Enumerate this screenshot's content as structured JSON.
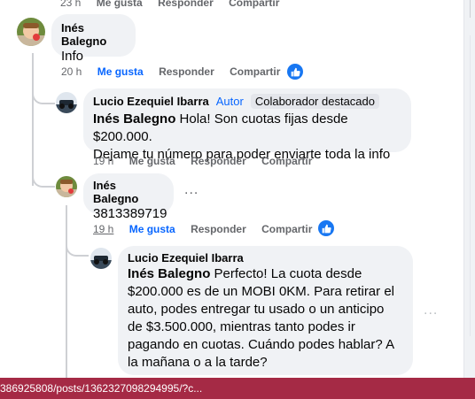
{
  "top_actions": {
    "time": "23 h",
    "like": "Me gusta",
    "reply": "Responder",
    "share": "Compartir"
  },
  "comment1": {
    "author": "Inés Balegno",
    "text": "Info",
    "time": "20 h",
    "like": "Me gusta",
    "reply": "Responder",
    "share": "Compartir"
  },
  "reply1": {
    "author": "Lucio Ezequiel Ibarra",
    "badge_author": "Autor",
    "badge_top": "Colaborador destacado",
    "mention": "Inés Balegno",
    "text_line1": " Hola! Son cuotas fijas desde $200.000.",
    "text_line2": "Dejame tu número para poder enviarte toda la info",
    "time": "19 h",
    "like": "Me gusta",
    "reply": "Responder",
    "share": "Compartir"
  },
  "reply2": {
    "author": "Inés Balegno",
    "text": "3813389719",
    "more": "...",
    "time": "19 h",
    "like": "Me gusta",
    "reply": "Responder",
    "share": "Compartir"
  },
  "reply3": {
    "author": "Lucio Ezequiel Ibarra",
    "mention": "Inés Balegno",
    "line1": " Perfecto! La cuota desde",
    "line2": "$200.000 es de un MOBI 0KM. Para retirar el",
    "line3": "auto, podes entregar tu usado o un anticipo",
    "line4": "de $3.500.000, mientras tanto podes ir",
    "line5": "pagando en cuotas. Cuándo podes hablar? A",
    "line6": "la mañana o a la tarde?",
    "more": "..."
  },
  "status_bar": {
    "url": "386925808/posts/1362327098294995/?c..."
  },
  "colors": {
    "accent": "#0866ff",
    "like_badge": "#1877f2",
    "status_bar": "#a52a45"
  }
}
